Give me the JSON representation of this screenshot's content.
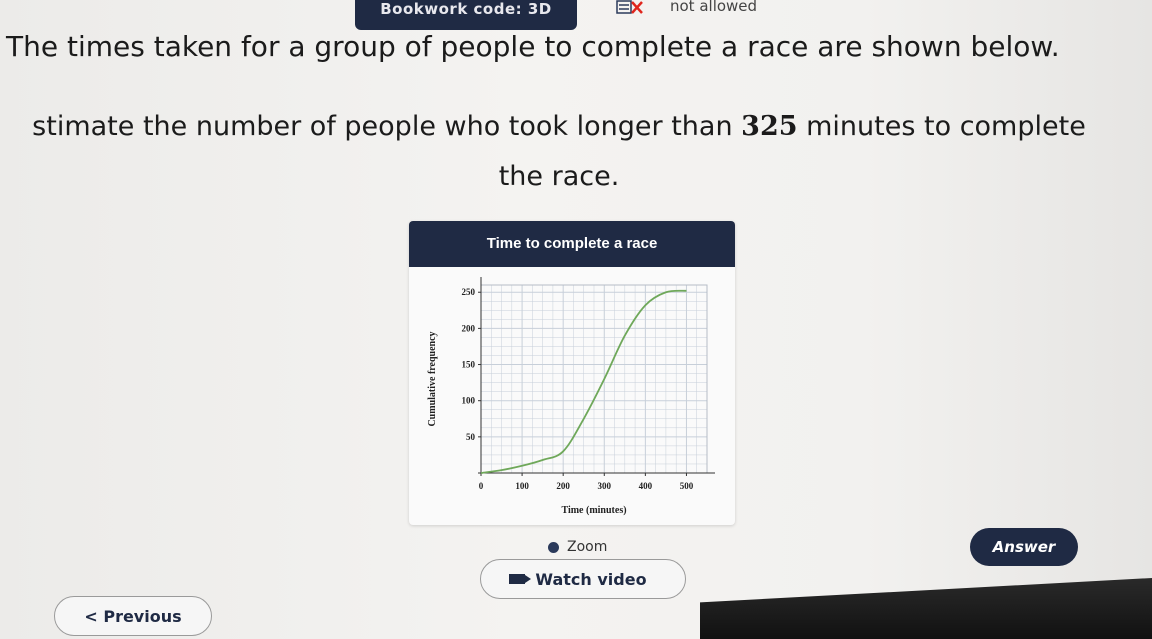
{
  "header": {
    "bookwork_label": "Bookwork code: 3D",
    "calculator_status": "not allowed"
  },
  "question": {
    "line1": "The times taken for a group of people to complete a race are shown below.",
    "line2_before": "stimate the number of people who took longer than ",
    "line2_number": "325",
    "line2_after": " minutes to complete",
    "line3": "the race."
  },
  "card": {
    "title": "Time to complete a race"
  },
  "chart_data": {
    "type": "line",
    "title": "Time to complete a race",
    "xlabel": "Time (minutes)",
    "ylabel": "Cumulative frequency",
    "xlim": [
      0,
      550
    ],
    "ylim": [
      0,
      260
    ],
    "x_ticks": [
      0,
      100,
      200,
      300,
      400,
      500
    ],
    "y_ticks": [
      0,
      50,
      100,
      150,
      200,
      250
    ],
    "grid": true,
    "series": [
      {
        "x": [
          0,
          50,
          100,
          150,
          200,
          250,
          300,
          350,
          400,
          450,
          500
        ],
        "y": [
          0,
          4,
          10,
          18,
          30,
          75,
          130,
          190,
          232,
          250,
          252
        ]
      }
    ]
  },
  "controls": {
    "zoom_label": "Zoom",
    "answer_label": "Answer",
    "watch_video_label": "Watch video",
    "previous_label": "< Previous"
  },
  "colors": {
    "navy": "#1f2a44",
    "curve": "#6fa85a",
    "grid": "#c7cfd9"
  }
}
